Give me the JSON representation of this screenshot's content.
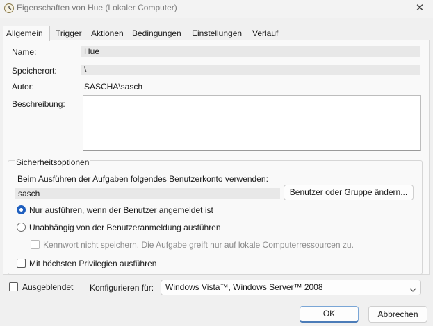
{
  "window": {
    "title": "Eigenschaften von Hue (Lokaler Computer)",
    "close_glyph": "✕"
  },
  "tabs": [
    {
      "label": "Allgemein"
    },
    {
      "label": "Trigger"
    },
    {
      "label": "Aktionen"
    },
    {
      "label": "Bedingungen"
    },
    {
      "label": "Einstellungen"
    },
    {
      "label": "Verlauf"
    }
  ],
  "general": {
    "name_label": "Name:",
    "name_value": "Hue",
    "location_label": "Speicherort:",
    "location_value": "\\",
    "author_label": "Autor:",
    "author_value": "SASCHA\\sasch",
    "description_label": "Beschreibung:",
    "description_value": ""
  },
  "security": {
    "group_title": "Sicherheitsoptionen",
    "account_prompt": "Beim Ausführen der Aufgaben folgendes Benutzerkonto verwenden:",
    "account_value": "sasch",
    "change_user_button": "Benutzer oder Gruppe ändern...",
    "radio_logged_on": "Nur ausführen, wenn der Benutzer angemeldet ist",
    "radio_logged_on_checked": true,
    "radio_whether_logged": "Unabhängig von der Benutzeranmeldung ausführen",
    "radio_whether_logged_checked": false,
    "no_password_label": "Kennwort nicht speichern. Die Aufgabe greift nur auf lokale Computerressourcen zu.",
    "highest_priv_label": "Mit höchsten Privilegien ausführen"
  },
  "bottom": {
    "hidden_label": "Ausgeblendet",
    "configure_label": "Konfigurieren für:",
    "configure_value": "Windows Vista™, Windows Server™ 2008"
  },
  "buttons": {
    "ok": "OK",
    "cancel": "Abbrechen"
  },
  "colors": {
    "accent": "#1f5fbf",
    "background": "#f0f0f0",
    "panel": "#f9f9f9"
  },
  "icons": {
    "title_icon": "clock-task-icon",
    "close_icon": "close-icon",
    "dropdown_icon": "chevron-down-icon"
  }
}
